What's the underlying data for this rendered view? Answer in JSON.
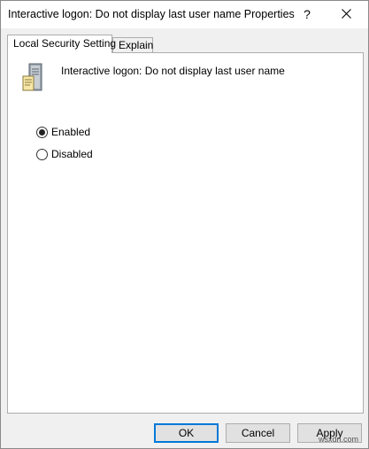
{
  "window": {
    "title": "Interactive logon: Do not display last user name Properties",
    "help_glyph": "?",
    "close_glyph": "close-icon"
  },
  "tabs": [
    {
      "label": "Local Security Setting",
      "active": true
    },
    {
      "label": "Explain",
      "active": false
    }
  ],
  "panel": {
    "policy_icon": "server-policy-icon",
    "policy_name": "Interactive logon: Do not display last user name",
    "options": [
      {
        "label": "Enabled",
        "checked": true
      },
      {
        "label": "Disabled",
        "checked": false
      }
    ]
  },
  "buttons": {
    "ok": "OK",
    "cancel": "Cancel",
    "apply": "Apply"
  },
  "watermark": "wsxdn.com",
  "colors": {
    "accent": "#0078d7",
    "dialog_bg": "#f0f0f0",
    "panel_bg": "#ffffff"
  }
}
